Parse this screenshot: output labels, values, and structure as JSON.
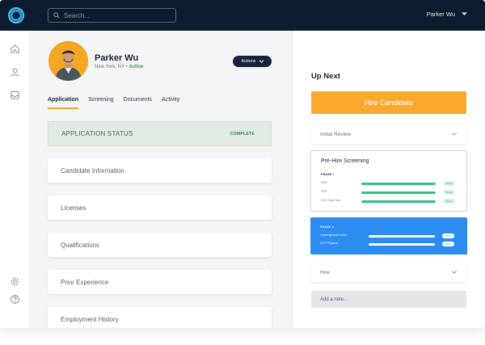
{
  "header": {
    "search_placeholder": "Search...",
    "user_name": "Parker Wu"
  },
  "profile": {
    "name": "Parker Wu",
    "location": "New York, NY",
    "status": "Active",
    "actions_label": "Actions"
  },
  "tabs": [
    {
      "label": "Application",
      "active": true
    },
    {
      "label": "Screening",
      "active": false
    },
    {
      "label": "Documents",
      "active": false
    },
    {
      "label": "Activity",
      "active": false
    }
  ],
  "application_status": {
    "title": "APPLICATION STATUS",
    "badge": "COMPLETE"
  },
  "sections": [
    "Candidate Information",
    "Licenses",
    "Qualifications",
    "Prior Experience",
    "Employment History"
  ],
  "up_next": {
    "title": "Up Next",
    "hire_button": "Hire Candidate",
    "initial_review": "Initial Review",
    "screening": {
      "title": "Pre-Hire Screening",
      "phase1": {
        "label": "PHASE I",
        "items": [
          {
            "label": "MVR",
            "progress": 100,
            "status": "Done"
          },
          {
            "label": "PSP",
            "progress": 100,
            "status": "Done"
          },
          {
            "label": "DOT Drug Test",
            "progress": 100,
            "status": "Done"
          }
        ]
      },
      "phase2": {
        "label": "PHASE II",
        "items": [
          {
            "label": "Clearinghouse Initial",
            "progress": 100,
            "status": "Done"
          },
          {
            "label": "DOT Physical",
            "progress": 100,
            "status": "Done"
          }
        ]
      }
    },
    "hire": "Hire",
    "note_placeholder": "Add a note..."
  },
  "colors": {
    "topbar": "#0d1b2e",
    "accent": "#f5a623",
    "hire_button": "#fba92c",
    "success": "#2ec27e",
    "phase2_bg": "#2d8cf0"
  }
}
